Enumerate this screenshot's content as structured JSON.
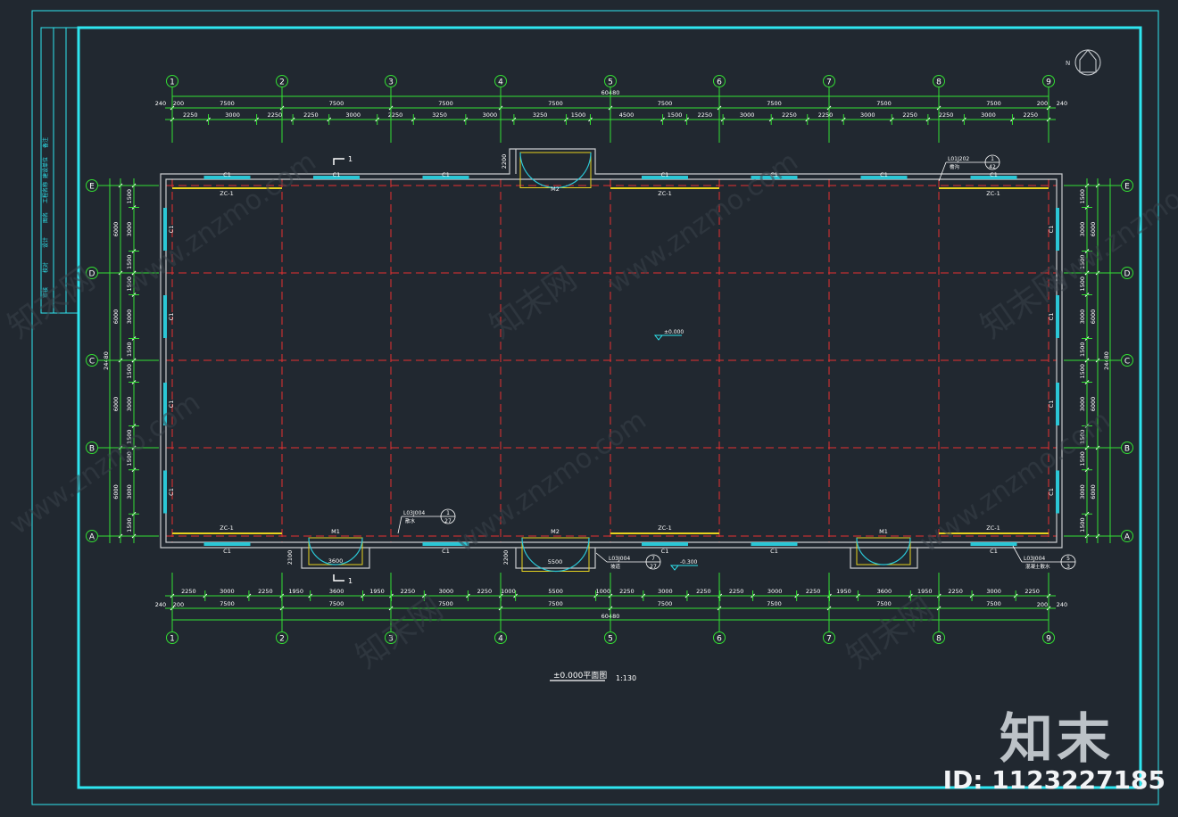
{
  "title": "±0.000平面图",
  "scale": "1:130",
  "axes": {
    "columns": [
      "1",
      "2",
      "3",
      "4",
      "5",
      "6",
      "7",
      "8",
      "9"
    ],
    "rows": [
      "E",
      "D",
      "C",
      "B",
      "A"
    ]
  },
  "dims": {
    "overall": "60480",
    "side_overall": "24480",
    "wall": "240",
    "wall2": "200",
    "wall3": "200",
    "top_bays": [
      "7500",
      "7500",
      "7500",
      "7500",
      "7500",
      "7500",
      "7500",
      "7500"
    ],
    "top_sub": [
      "2250",
      "3000",
      "2250",
      "2250",
      "3000",
      "2250",
      "3250",
      "3000",
      "3250",
      "1500",
      "4500",
      "1500",
      "2250",
      "3000",
      "2250",
      "2250",
      "3000",
      "2250",
      "2250",
      "3000",
      "2250"
    ],
    "bottom_bays": [
      "7500",
      "7500",
      "7500",
      "7500",
      "7500",
      "7500",
      "7500",
      "7500"
    ],
    "bottom_sub": [
      "2250",
      "3000",
      "2250",
      "1950",
      "3600",
      "1950",
      "2250",
      "3000",
      "2250",
      "1000",
      "5500",
      "1000",
      "2250",
      "3000",
      "2250",
      "2250",
      "3000",
      "2250",
      "1950",
      "3600",
      "1950",
      "2250",
      "3000",
      "2250"
    ],
    "side_bays": [
      "6000",
      "6000",
      "6000",
      "6000"
    ],
    "side_sub": [
      "1500",
      "3000",
      "1500"
    ]
  },
  "labels": {
    "window": "C1",
    "window_strip": "ZC-1",
    "door_m1": "M1",
    "door_m2": "M2",
    "m1_width": "3600",
    "m2_width": "5500",
    "m1_height": "2100",
    "m2_height": "2200",
    "level_inside": "±0.000",
    "level_outside": "-0.300",
    "section_mark": "1",
    "north": "N"
  },
  "callouts": [
    {
      "code": "L03J004",
      "note": "散水",
      "num": "1",
      "page": "27"
    },
    {
      "code": "L03J004",
      "note": "坡道",
      "num": "7",
      "page": "27"
    },
    {
      "code": "L03J004",
      "note": "混凝土散水",
      "num": "5",
      "page": "3"
    },
    {
      "code": "L01J202",
      "note": "檐沟",
      "num": "1",
      "page": "42"
    }
  ],
  "title_block": [
    "备注",
    "建设单位",
    "工程名称",
    "图名",
    "设计",
    "校对",
    "审核"
  ],
  "watermark": {
    "text": "www.znzmo.com",
    "brand": "知末",
    "cn": "知末网",
    "id": "ID: 1123227185"
  },
  "colors": {
    "bg": "#212830",
    "frame": "#2ee6f0",
    "dim": "#33e033",
    "axis": "#e83030",
    "wall": "#c9ccce",
    "glass": "#2bc7d6",
    "strip": "#e6d21e",
    "text": "#ffffff",
    "level": "#2ee6f0"
  }
}
